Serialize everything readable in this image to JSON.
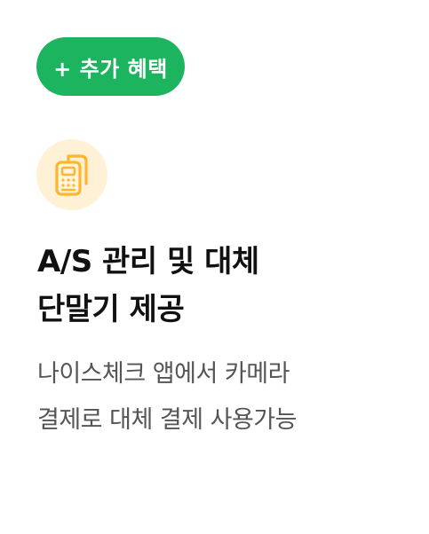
{
  "badge": {
    "label": "+ 추가 혜택",
    "color": "#1DB45F"
  },
  "feature": {
    "icon": "card-terminal-icon",
    "icon_bg_color": "#FFF1D6",
    "icon_color": "#FFB62E",
    "title_lines": [
      "A/S 관리 및 대체",
      "단말기 제공"
    ],
    "description_lines": [
      "나이스체크 앱에서 카메라",
      "결제로 대체 결제 사용가능"
    ]
  }
}
